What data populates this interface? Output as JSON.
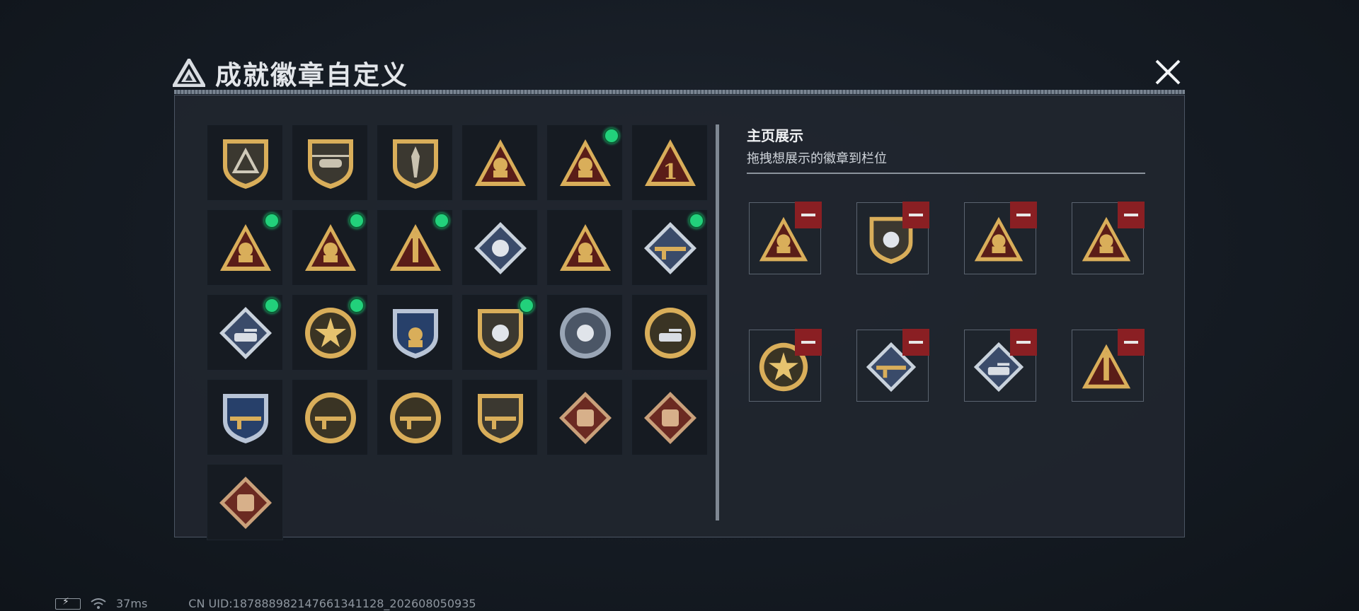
{
  "header": {
    "title": "成就徽章自定义"
  },
  "colors": {
    "gold": "#d9ae5a",
    "dark_red": "#5a1d18",
    "green_dot": "#22d17b",
    "remove_red": "#8a1f23",
    "steel": "#9aa6b6"
  },
  "badges": [
    {
      "icon": "shield-triangle-emblem",
      "new": false
    },
    {
      "icon": "helicopter-shield",
      "new": false
    },
    {
      "icon": "dagger-shield",
      "new": false
    },
    {
      "icon": "rock-hand-triangle",
      "new": false
    },
    {
      "icon": "helmet-triangle",
      "new": true
    },
    {
      "icon": "number-one-triangle",
      "new": false
    },
    {
      "icon": "soldier-wave-triangle",
      "new": true
    },
    {
      "icon": "soldiers-triangle",
      "new": true
    },
    {
      "icon": "rocket-triangle",
      "new": true
    },
    {
      "icon": "rose-diamond",
      "new": false
    },
    {
      "icon": "diver-triangle",
      "new": false
    },
    {
      "icon": "launcher-diamond",
      "new": true
    },
    {
      "icon": "tank-fist-diamond",
      "new": true
    },
    {
      "icon": "star-seal-round",
      "new": true
    },
    {
      "icon": "eagle-shield-blue",
      "new": false
    },
    {
      "icon": "gem-shield",
      "new": true
    },
    {
      "icon": "skull-wreath-silver",
      "new": false
    },
    {
      "icon": "tank-sunburst",
      "new": false
    },
    {
      "icon": "crosshair-rifle-shield",
      "new": false
    },
    {
      "icon": "rifle-round-shield",
      "new": false
    },
    {
      "icon": "rifle-round-shield",
      "new": false
    },
    {
      "icon": "jets-shield-gold",
      "new": false
    },
    {
      "icon": "dragon-diamond",
      "new": false
    },
    {
      "icon": "vehicle-diamond",
      "new": false
    },
    {
      "icon": "ammo-diamond",
      "new": false
    }
  ],
  "showcase": {
    "title": "主页展示",
    "subtitle": "拖拽想展示的徽章到栏位",
    "slots": [
      {
        "icon": "soldiers-triangle"
      },
      {
        "icon": "gem-shield"
      },
      {
        "icon": "soldier-wave-triangle"
      },
      {
        "icon": "helmet-triangle"
      },
      {
        "icon": "star-seal-round"
      },
      {
        "icon": "launcher-diamond"
      },
      {
        "icon": "tank-fist-diamond"
      },
      {
        "icon": "rocket-triangle"
      }
    ]
  },
  "status": {
    "ping": "37ms",
    "uid": "CN UID:187888982147661341128_202608050935"
  }
}
